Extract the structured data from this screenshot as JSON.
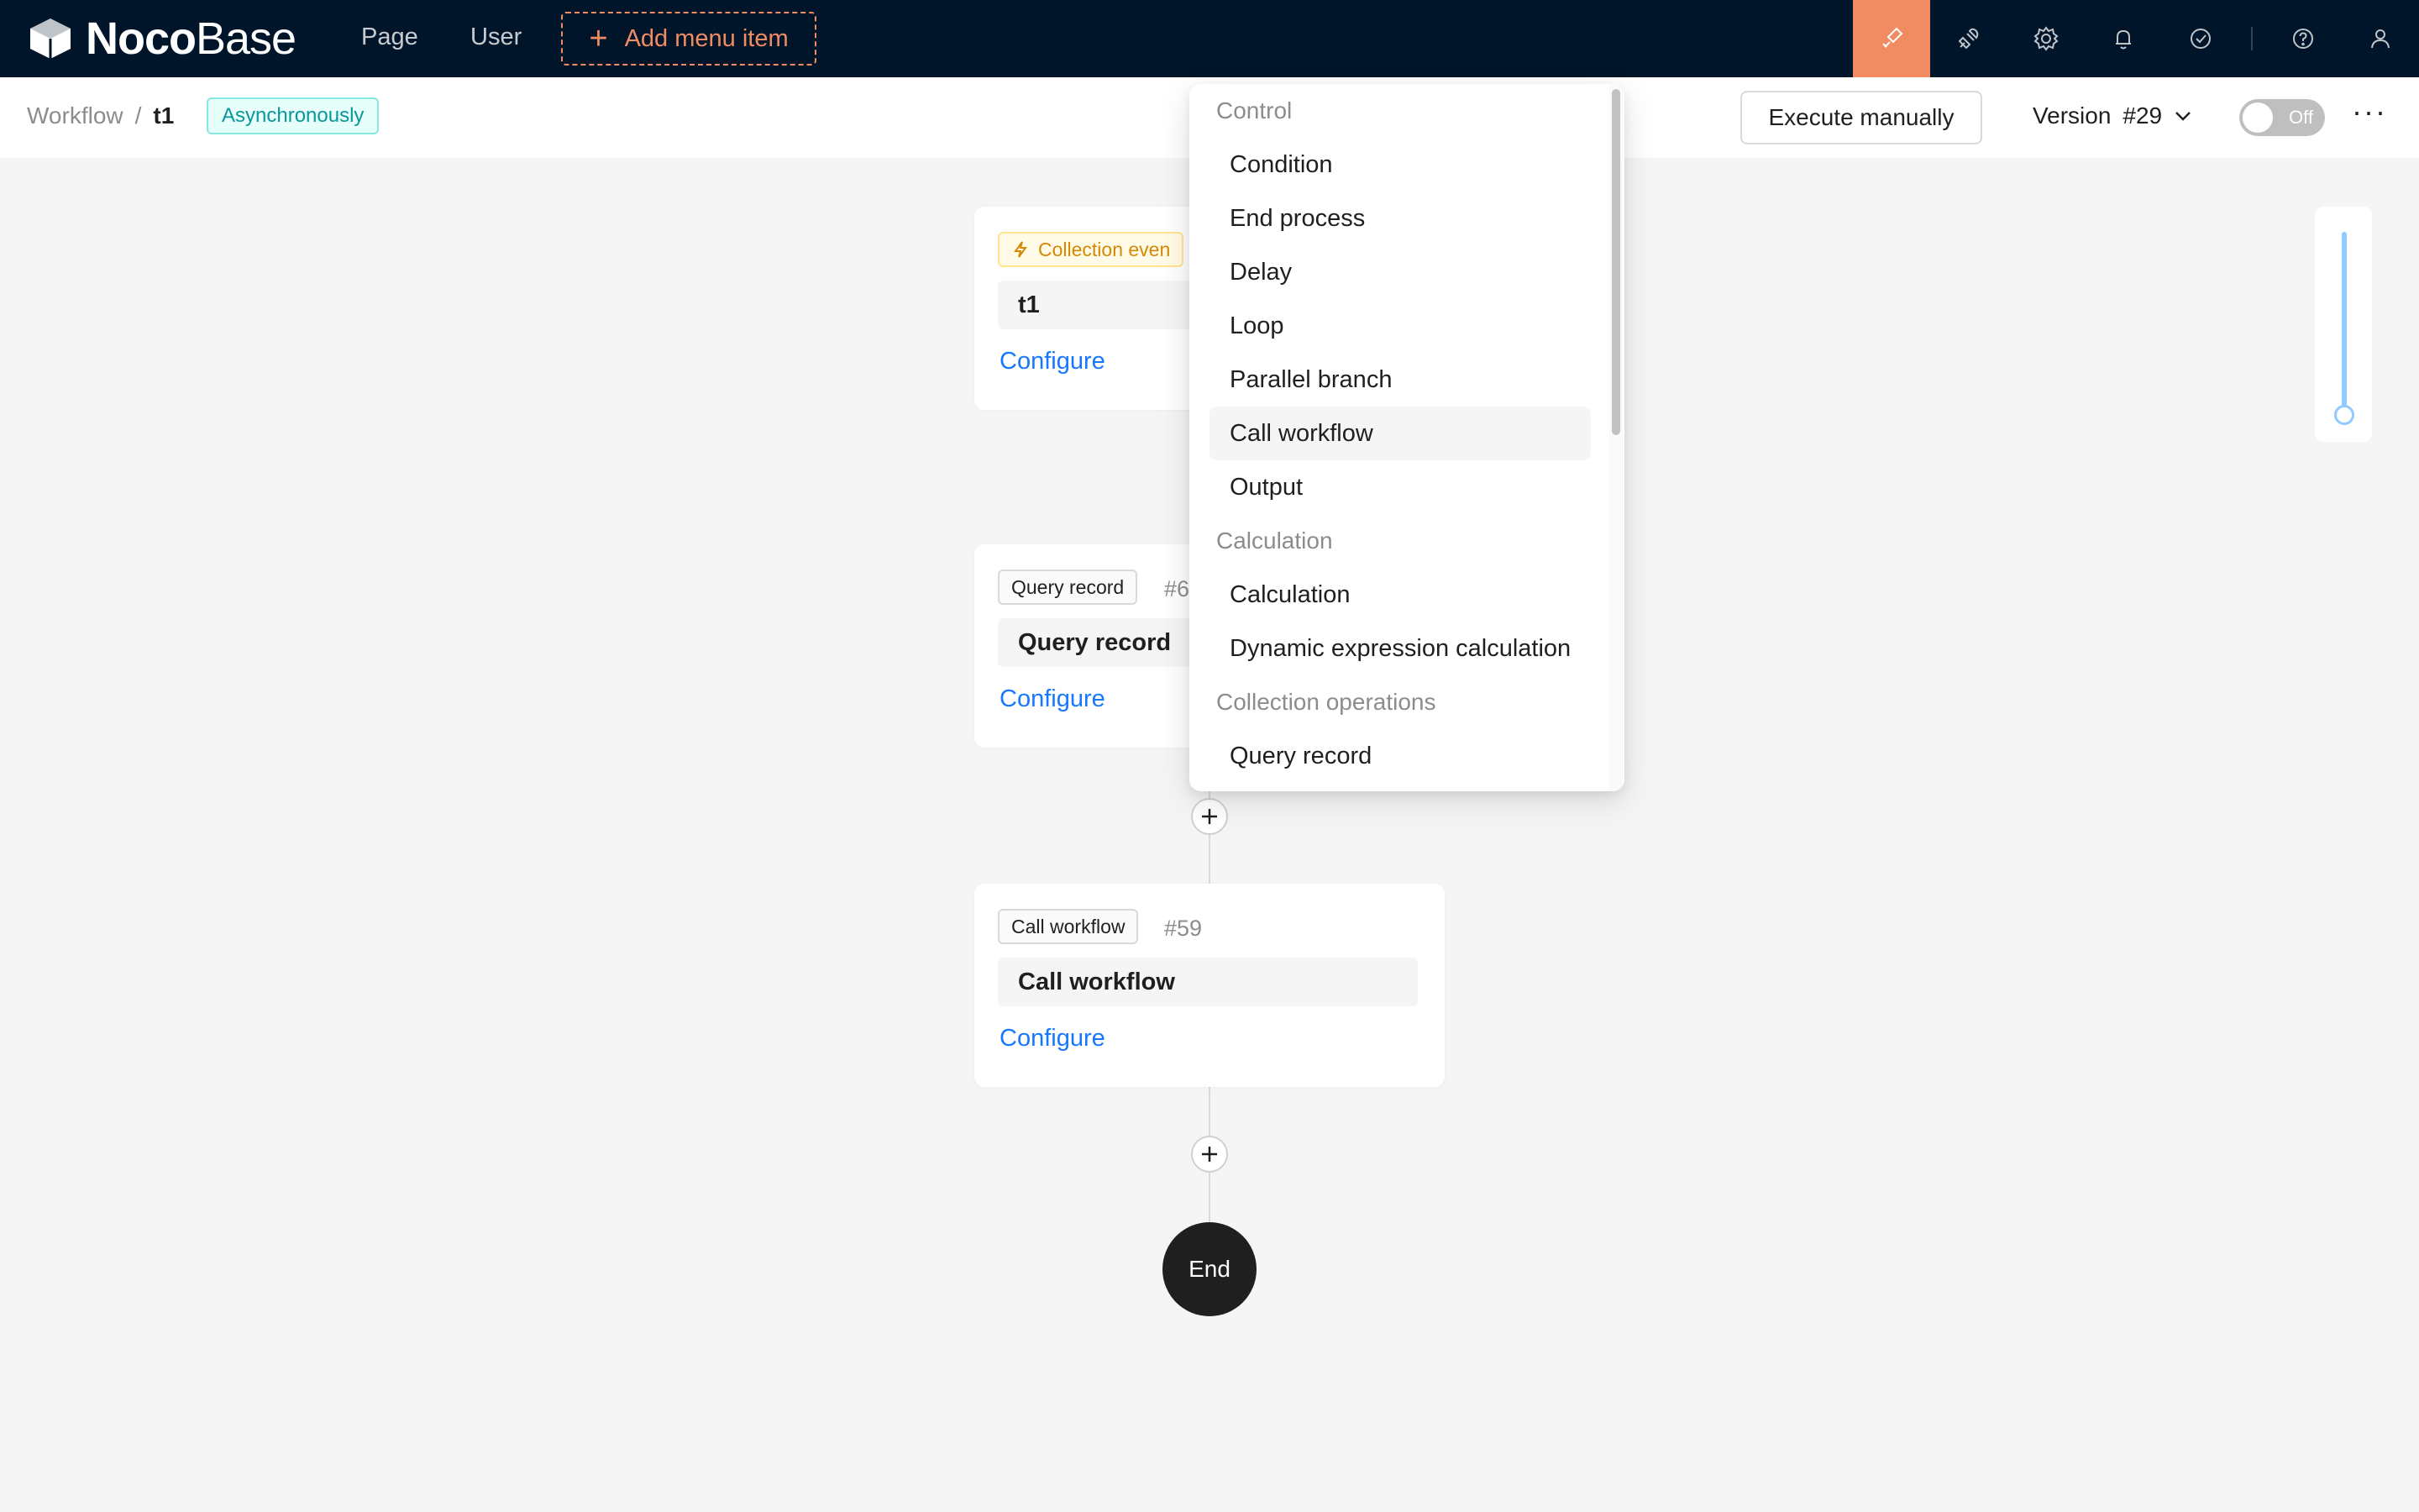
{
  "topbar": {
    "logo_bold": "Noco",
    "logo_light": "Base",
    "nav": [
      "Page",
      "User"
    ],
    "add_menu_label": "Add menu item",
    "icons": [
      "brush-icon",
      "plugin-icon",
      "gear-icon",
      "bell-icon",
      "check-circle-icon",
      "help-icon",
      "user-icon"
    ]
  },
  "header": {
    "breadcrumb_root": "Workflow",
    "breadcrumb_sep": "/",
    "breadcrumb_current": "t1",
    "mode_tag": "Asynchronously",
    "execute_label": "Execute manually",
    "version_label": "Version",
    "version_value": "#29",
    "toggle_label": "Off",
    "more_label": "···"
  },
  "nodes": [
    {
      "tag": "Collection even",
      "id": "",
      "title": "t1",
      "action": "Configure"
    },
    {
      "tag": "Query record",
      "id": "#6",
      "title": "Query record",
      "action": "Configure"
    },
    {
      "tag": "Call workflow",
      "id": "#59",
      "title": "Call workflow",
      "action": "Configure"
    }
  ],
  "end_label": "End",
  "zoom": {
    "level": 1.0
  },
  "menu": {
    "groups": [
      {
        "label": "Control",
        "items": [
          "Condition",
          "End process",
          "Delay",
          "Loop",
          "Parallel branch",
          "Call workflow",
          "Output"
        ]
      },
      {
        "label": "Calculation",
        "items": [
          "Calculation",
          "Dynamic expression calculation"
        ]
      },
      {
        "label": "Collection operations",
        "items": [
          "Query record"
        ]
      }
    ],
    "hovered": "Call workflow"
  }
}
